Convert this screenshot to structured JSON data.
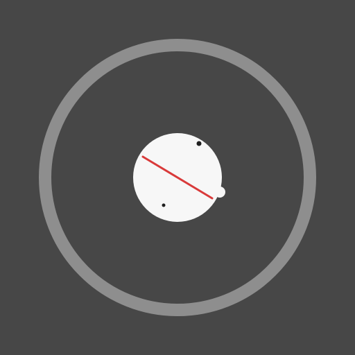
{
  "game": {
    "title": "",
    "score_text": ""
  },
  "scene": {
    "colors": {
      "background": "#474747",
      "arena_ring": "#8e8e8e",
      "ball": "#f7f7f7",
      "paddle_line": "#d93a3a",
      "dots": "#1f1f1f"
    },
    "icons": {
      "arena": "ring-icon",
      "player": "disc-icon",
      "stick": "line-icon",
      "marker": "dot-icon"
    }
  }
}
